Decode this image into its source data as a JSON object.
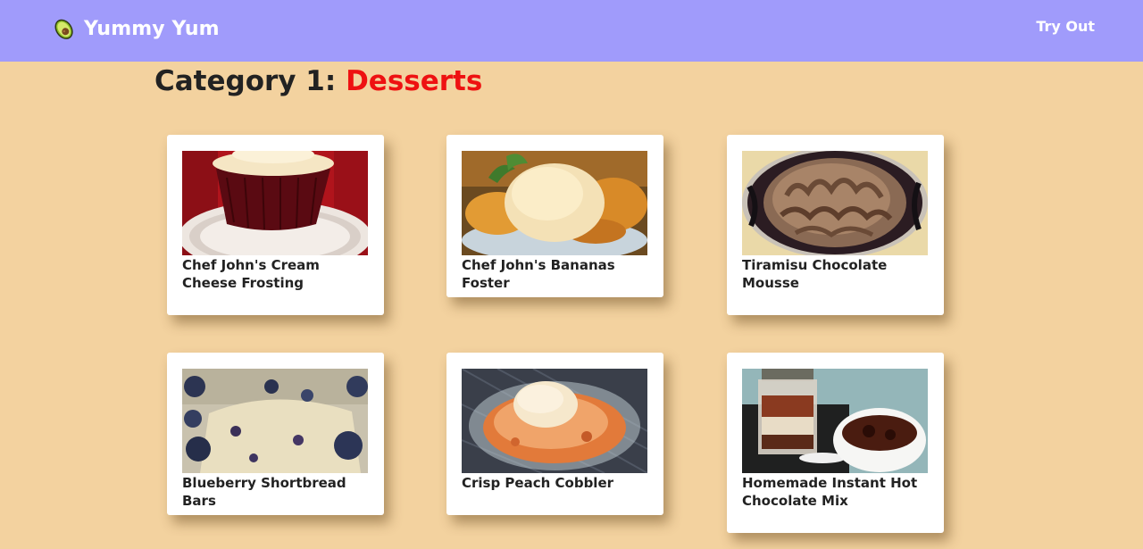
{
  "navbar": {
    "brand": "Yummy Yum",
    "logo_icon": "avocado-icon",
    "link": "Try Out",
    "background": "#a09bfb"
  },
  "heading": {
    "prefix": "Category 1: ",
    "category": "Desserts",
    "category_color": "#ee1111"
  },
  "recipes": [
    {
      "title": "Chef John's Cream Cheese Frosting",
      "image": "red-velvet-cupcake-photo"
    },
    {
      "title": "Chef John's Bananas Foster",
      "image": "bananas-foster-photo"
    },
    {
      "title": "Tiramisu Chocolate Mousse",
      "image": "chocolate-mousse-photo"
    },
    {
      "title": "Blueberry Shortbread Bars",
      "image": "blueberry-bars-photo"
    },
    {
      "title": "Crisp Peach Cobbler",
      "image": "peach-cobbler-photo"
    },
    {
      "title": "Homemade Instant Hot Chocolate Mix",
      "image": "hot-chocolate-photo"
    }
  ],
  "page_background": "#f3d29f"
}
